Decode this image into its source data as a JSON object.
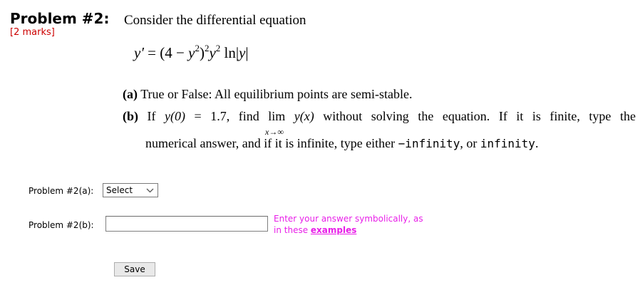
{
  "problem": {
    "title": "Problem #2:",
    "intro": "Consider the differential equation",
    "marks": "[2 marks]"
  },
  "equation": {
    "lhs": "y′",
    "eq": "=",
    "open": "(4 − ",
    "y1": "y",
    "exp2a": "2",
    "close": ")",
    "exp2b": "2",
    "y2": "y",
    "exp2c": "2",
    "ln": " ln|",
    "y3": "y",
    "bar": "|"
  },
  "parts": {
    "a": {
      "label": "(a)",
      "text": "True or False: All equilibrium points are semi-stable."
    },
    "b": {
      "label": "(b)",
      "if": "If",
      "cond": "y(0)",
      "eq": "=",
      "value": "1.7,",
      "find": "find",
      "lim": "lim",
      "limexpr": "y(x)",
      "w1": "without",
      "w2": "solving",
      "w3": "the",
      "w4": "equation.",
      "w5": "If",
      "w6": "it",
      "w7": "is",
      "w8": "finite,",
      "w9": "type",
      "w10": "the",
      "lim_sub": "x→∞",
      "line2_a": "numerical answer, and if it is infinite, type either ",
      "neg_inf": "−infinity",
      "line2_b": ", or ",
      "pos_inf": "infinity",
      "line2_c": "."
    }
  },
  "answers": {
    "a": {
      "label": "Problem #2(a):",
      "select_value": "Select"
    },
    "b": {
      "label": "Problem #2(b):",
      "value": "",
      "hint_line1": "Enter your answer symbolically, as",
      "hint_line2": "in these ",
      "hint_link": "examples"
    }
  },
  "save_label": "Save"
}
